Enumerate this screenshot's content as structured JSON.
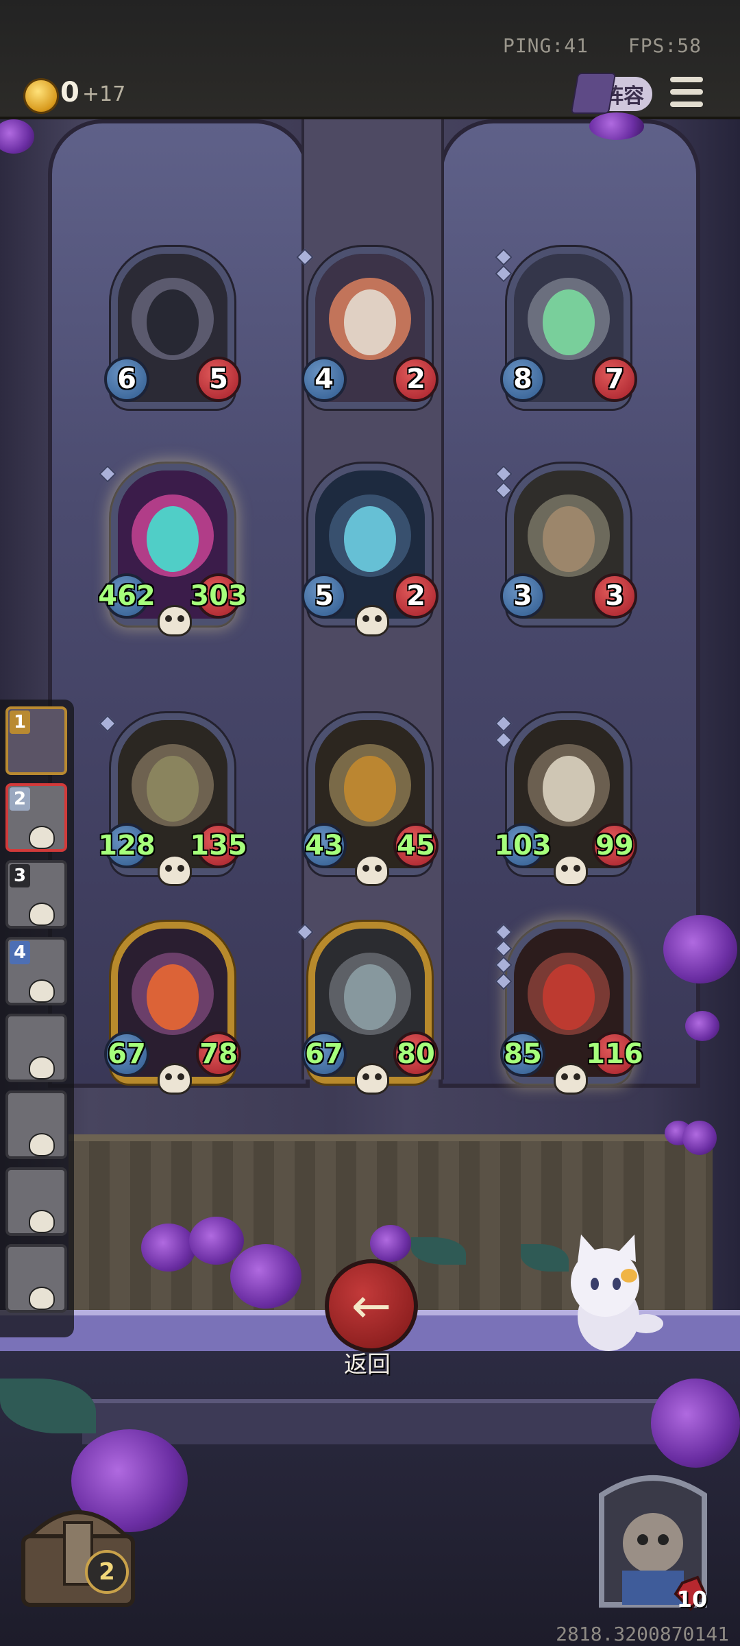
{
  "status": {
    "ping": "PING:41",
    "fps": "FPS:58"
  },
  "currency": {
    "amount": "0",
    "gain": "+17",
    "icon": "gold-crown-coin-icon"
  },
  "header": {
    "lineup_label": "阵容",
    "menu_icon": "hamburger-menu-icon"
  },
  "board": {
    "cards": [
      {
        "name": "hooded-assassin",
        "attack": "6",
        "health": "5",
        "pips": 0
      },
      {
        "name": "clown-jester",
        "attack": "4",
        "health": "2",
        "pips": 1
      },
      {
        "name": "green-ghost-cat",
        "attack": "8",
        "health": "7",
        "pips": 2
      },
      {
        "name": "spectral-wolf",
        "attack": "462",
        "health": "303",
        "pips": 1
      },
      {
        "name": "blue-ghost-imp",
        "attack": "5",
        "health": "2",
        "pips": 0
      },
      {
        "name": "airship-wreck",
        "attack": "3",
        "health": "3",
        "pips": 2
      },
      {
        "name": "steam-submarine",
        "attack": "128",
        "health": "135",
        "pips": 1
      },
      {
        "name": "armored-beetle",
        "attack": "43",
        "health": "45",
        "pips": 0
      },
      {
        "name": "bone-dragon-skull",
        "attack": "103",
        "health": "99",
        "pips": 2
      },
      {
        "name": "witch-girl",
        "attack": "67",
        "health": "78",
        "pips": 0
      },
      {
        "name": "robot-ufo-lamp",
        "attack": "67",
        "health": "80",
        "pips": 1
      },
      {
        "name": "red-mecha-dragon",
        "attack": "85",
        "health": "116",
        "pips": 4
      }
    ]
  },
  "roster": {
    "slots": [
      {
        "number": "1",
        "state": "active"
      },
      {
        "number": "2",
        "state": "selected"
      },
      {
        "number": "3",
        "state": "eliminated"
      },
      {
        "number": "4",
        "state": "eliminated"
      },
      {
        "number": "",
        "state": "eliminated"
      },
      {
        "number": "",
        "state": "eliminated"
      },
      {
        "number": "",
        "state": "eliminated"
      },
      {
        "number": "",
        "state": "eliminated"
      }
    ]
  },
  "back_button": {
    "label": "返回",
    "icon": "left-arrow-icon"
  },
  "bottom": {
    "chest_count": "2",
    "hero_health": "10",
    "seed": "2818.3200870141"
  },
  "colors": {
    "gold": "#b88a2c",
    "attack_blue": "#2f5b8f",
    "health_red": "#a51f2a",
    "buffed_green": "#a6ff7c"
  }
}
